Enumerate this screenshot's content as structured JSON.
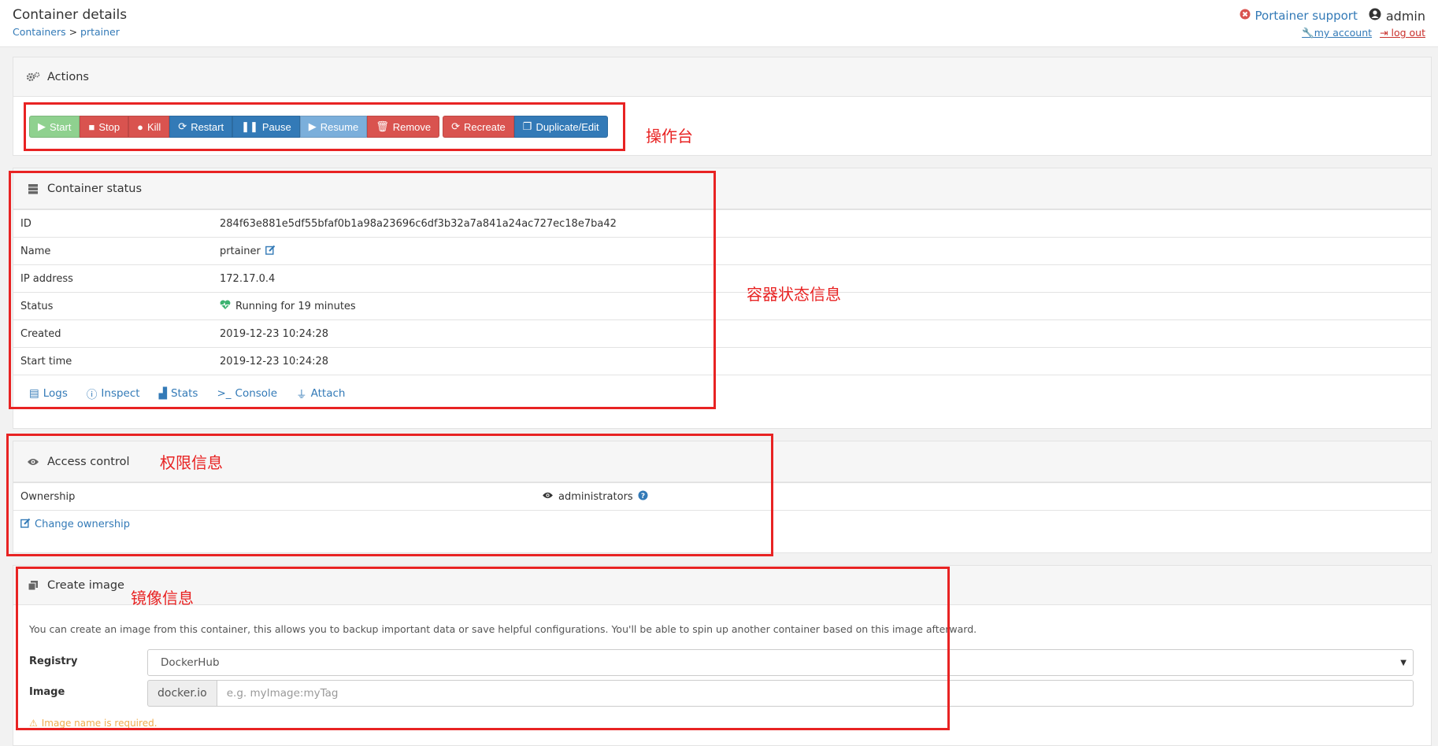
{
  "header": {
    "title": "Container details",
    "breadcrumb_link": "Containers",
    "breadcrumb_sep": " > ",
    "breadcrumb_current": "prtainer",
    "support_label": "Portainer support",
    "username": "admin",
    "my_account": "my account",
    "log_out": "log out"
  },
  "actions": {
    "title": "Actions",
    "buttons": {
      "start": "Start",
      "stop": "Stop",
      "kill": "Kill",
      "restart": "Restart",
      "pause": "Pause",
      "resume": "Resume",
      "remove": "Remove",
      "recreate": "Recreate",
      "duplicate": "Duplicate/Edit"
    }
  },
  "status": {
    "title": "Container status",
    "rows": [
      {
        "key": "ID",
        "value": "284f63e881e5df55bfaf0b1a98a23696c6df3b32a7a841a24ac727ec18e7ba42"
      },
      {
        "key": "Name",
        "value": "prtainer"
      },
      {
        "key": "IP address",
        "value": "172.17.0.4"
      },
      {
        "key": "Status",
        "value": "Running for 19 minutes"
      },
      {
        "key": "Created",
        "value": "2019-12-23 10:24:28"
      },
      {
        "key": "Start time",
        "value": "2019-12-23 10:24:28"
      }
    ],
    "links": {
      "logs": "Logs",
      "inspect": "Inspect",
      "stats": "Stats",
      "console": "Console",
      "attach": "Attach"
    }
  },
  "access": {
    "title": "Access control",
    "ownership_label": "Ownership",
    "ownership_value": "administrators",
    "change_ownership": "Change ownership"
  },
  "create_image": {
    "title": "Create image",
    "description": "You can create an image from this container, this allows you to backup important data or save helpful configurations. You'll be able to spin up another container based on this image afterward.",
    "registry_label": "Registry",
    "registry_value": "DockerHub",
    "image_label": "Image",
    "image_prefix": "docker.io",
    "image_placeholder": "e.g. myImage:myTag",
    "warning": "Image name is required."
  },
  "annotations": {
    "actions": "操作台",
    "status": "容器状态信息",
    "access": "权限信息",
    "image": "镜像信息"
  },
  "colors": {
    "annotation": "#e82323",
    "primary": "#337ab7",
    "danger": "#d9534f",
    "success": "#8fd18f"
  }
}
